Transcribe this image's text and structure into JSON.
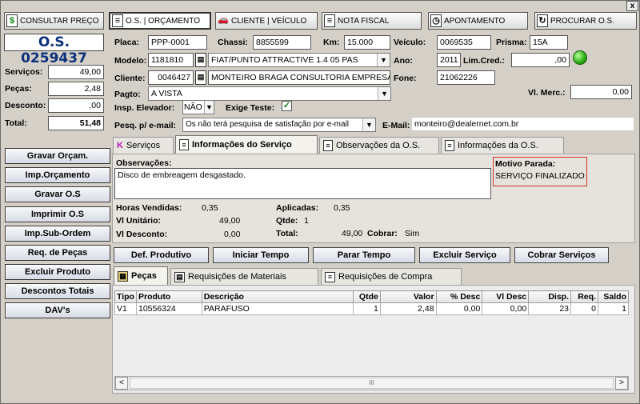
{
  "window": {
    "close_label": "x"
  },
  "top_buttons": {
    "consultar": "CONSULTAR PREÇO",
    "os": "O.S. | ORÇAMENTO",
    "cliente": "CLIENTE | VEÍCULO",
    "nota": "NOTA FISCAL",
    "apontamento": "APONTAMENTO",
    "procurar": "PROCURAR O.S."
  },
  "os_number": "O.S. 0259437",
  "summary": {
    "servicos_label": "Serviços:",
    "servicos": "49,00",
    "pecas_label": "Peças:",
    "pecas": "2,48",
    "desconto_label": "Desconto:",
    "desconto": ",00",
    "total_label": "Total:",
    "total": "51,48"
  },
  "side_buttons": {
    "gravar_orcam": "Gravar Orçam.",
    "imp_orcamento": "Imp.Orçamento",
    "gravar_os": "Gravar O.S",
    "imprimir_os": "Imprimir O.S",
    "imp_sub_ordem": "Imp.Sub-Ordem",
    "req_pecas": "Req. de Peças",
    "excluir_produto": "Excluir Produto",
    "descontos_totais": "Descontos Totais",
    "davs": "DAV's"
  },
  "form": {
    "placa_label": "Placa:",
    "placa": "PPP-0001",
    "chassi_label": "Chassi:",
    "chassi": "8855599",
    "km_label": "Km:",
    "km": "15.000",
    "veiculo_label": "Veículo:",
    "veiculo": "0069535",
    "prisma_label": "Prisma:",
    "prisma": "15A",
    "modelo_label": "Modelo:",
    "modelo_code": "1181810",
    "modelo_desc": "FIAT/PUNTO ATTRACTIVE 1.4   05 PAS",
    "ano_label": "Ano:",
    "ano": "2011",
    "limcred_label": "Lim.Cred.:",
    "limcred": ",00",
    "cliente_label": "Cliente:",
    "cliente_code": "0046427",
    "cliente_name": "MONTEIRO BRAGA CONSULTORIA EMPRESARIAL",
    "fone_label": "Fone:",
    "fone": "21062226",
    "pagto_label": "Pagto:",
    "pagto": "A VISTA",
    "vlmerc_label": "Vl. Merc.:",
    "vlmerc": "0,00",
    "insp_label": "Insp. Elevador:",
    "insp": "NÃO",
    "exige_label": "Exige Teste:",
    "exige_checked": "✓",
    "pesq_label": "Pesq. p/ e-mail:",
    "pesq": "Os não terá pesquisa de satisfação por e-mail",
    "email_label": "E-Mail:",
    "email": "monteiro@dealernet.com.br"
  },
  "tabs": {
    "servicos": "Serviços",
    "info_servico": "Informações do Serviço",
    "obs_os": "Observações da O.S.",
    "info_os": "Informações da O.S."
  },
  "service_info": {
    "obs_label": "Observações:",
    "obs_text": "Disco de embreagem desgastado.",
    "motivo_label": "Motivo Parada:",
    "motivo_value": "SERVIÇO FINALIZADO",
    "horas_label": "Horas Vendidas:",
    "horas": "0,35",
    "aplicadas_label": "Aplicadas:",
    "aplicadas": "0,35",
    "vlunit_label": "Vl Unitário:",
    "vlunit": "49,00",
    "qtde_label": "Qtde:",
    "qtde": "1",
    "vldesc_label": "Vl Desconto:",
    "vldesc": "0,00",
    "total_label": "Total:",
    "total": "49,00",
    "cobrar_label": "Cobrar:",
    "cobrar": "Sim"
  },
  "action_buttons": {
    "def_produtivo": "Def. Produtivo",
    "iniciar_tempo": "Iniciar Tempo",
    "parar_tempo": "Parar Tempo",
    "excluir_servico": "Excluir Serviço",
    "cobrar_servicos": "Cobrar Serviços"
  },
  "subtabs": {
    "pecas": "Peças",
    "req_materiais": "Requisições de Materiais",
    "req_compra": "Requisições de Compra"
  },
  "grid": {
    "headers": [
      "Tipo",
      "Produto",
      "Descrição",
      "Qtde",
      "Valor",
      "% Desc",
      "Vl Desc",
      "Disp.",
      "Req.",
      "Saldo"
    ],
    "rows": [
      [
        "V1",
        "10556324",
        "PARAFUSO",
        "1",
        "2,48",
        "0,00",
        "0,00",
        "23",
        "0",
        "1"
      ]
    ]
  },
  "scroll": {
    "left": "<",
    "right": ">",
    "thumb": "III"
  }
}
